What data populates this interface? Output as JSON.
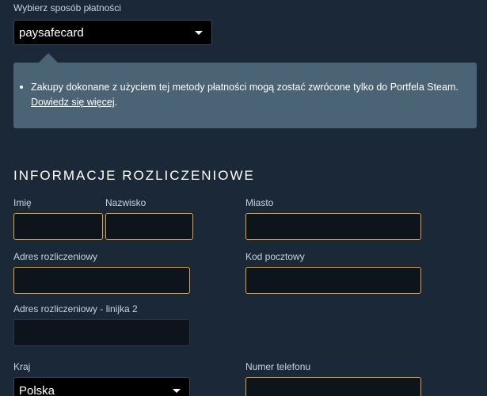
{
  "payment": {
    "method_label": "Wybierz sposób płatności",
    "method_value": "paysafecard",
    "info_text": "Zakupy dokonane z użyciem tej metody płatności mogą zostać zwrócone tylko do Portfela Steam.",
    "info_link": "Dowiedz się więcej",
    "info_suffix": "."
  },
  "billing": {
    "title": "INFORMACJE ROZLICZENIOWE",
    "first_name_label": "Imię",
    "first_name_value": "",
    "last_name_label": "Nazwisko",
    "last_name_value": "",
    "city_label": "Miasto",
    "city_value": "",
    "address_label": "Adres rozliczeniowy",
    "address_value": "",
    "postal_label": "Kod pocztowy",
    "postal_value": "",
    "address2_label": "Adres rozliczeniowy - linijka 2",
    "address2_value": "",
    "country_label": "Kraj",
    "country_value": "Polska",
    "phone_label": "Numer telefonu",
    "phone_value": ""
  },
  "colors": {
    "background": "#1b2838",
    "info_box": "#4a6375",
    "required_border": "#e0a43a"
  }
}
